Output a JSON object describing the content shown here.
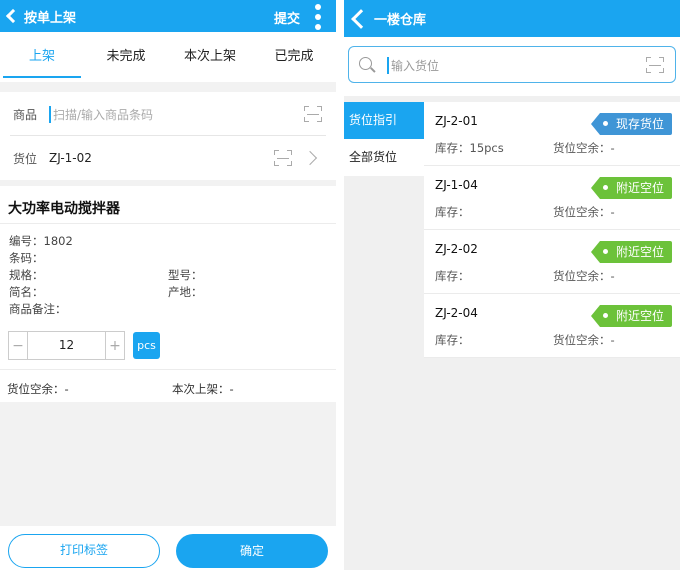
{
  "left": {
    "header": {
      "title": "按单上架",
      "submit_label": "提交"
    },
    "tabs": [
      {
        "label": "上架",
        "active": true
      },
      {
        "label": "未完成",
        "active": false
      },
      {
        "label": "本次上架",
        "active": false
      },
      {
        "label": "已完成",
        "active": false
      }
    ],
    "product_field": {
      "label": "商品",
      "placeholder": "扫描/输入商品条码"
    },
    "location_field": {
      "label": "货位",
      "value": "ZJ-1-02"
    },
    "product": {
      "name": "大功率电动搅拌器",
      "number_line": "编号：1802",
      "barcode_line": "条码：",
      "spec_line": "规格：",
      "model_line": "型号：",
      "short_name_line": "简名：",
      "origin_line": "产地：",
      "note_line": "商品备注："
    },
    "quantity": {
      "value": "12",
      "minus": "−",
      "plus": "+",
      "unit": "pcs"
    },
    "location_space": "货位空余：-",
    "this_time": "本次上架：-",
    "buttons": {
      "print": "打印标签",
      "confirm": "确定"
    }
  },
  "right": {
    "header": {
      "title": "一楼仓库"
    },
    "search": {
      "placeholder": "输入货位"
    },
    "nav": [
      {
        "label": "货位指引",
        "active": true
      },
      {
        "label": "全部货位",
        "active": false
      }
    ],
    "items": [
      {
        "code": "ZJ-2-01",
        "stock": "库存：15pcs",
        "space": "货位空余：-",
        "tag": "现存货位",
        "tag_color": "#3f95d6"
      },
      {
        "code": "ZJ-1-04",
        "stock": "库存：",
        "space": "货位空余：-",
        "tag": "附近空位",
        "tag_color": "#6cc23a"
      },
      {
        "code": "ZJ-2-02",
        "stock": "库存：",
        "space": "货位空余：-",
        "tag": "附近空位",
        "tag_color": "#6cc23a"
      },
      {
        "code": "ZJ-2-04",
        "stock": "库存：",
        "space": "货位空余：-",
        "tag": "附近空位",
        "tag_color": "#6cc23a"
      }
    ]
  },
  "colors": {
    "accent": "#1aa5f0",
    "tag_blue": "#3f95d6",
    "tag_green": "#6cc23a"
  }
}
